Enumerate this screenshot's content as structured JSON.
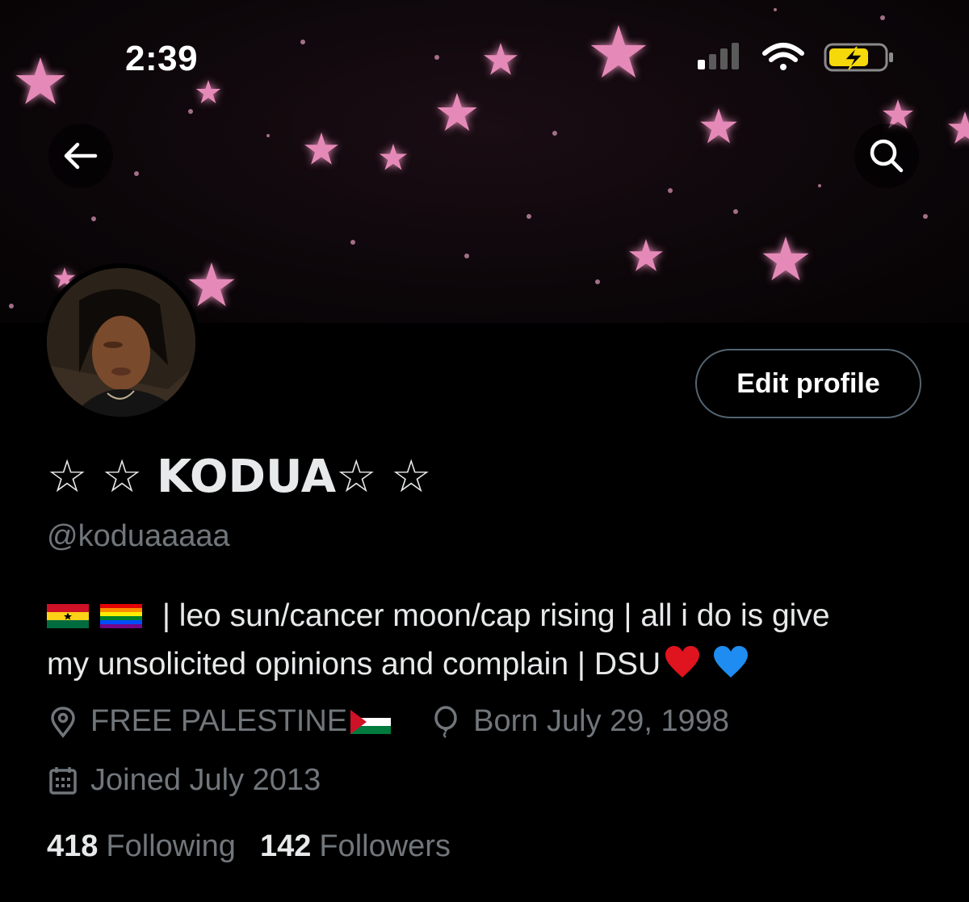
{
  "status_bar": {
    "time": "2:39",
    "icons": [
      "signal-icon",
      "wifi-icon",
      "battery-charging-icon"
    ],
    "battery_color": "#f5d90a"
  },
  "nav": {
    "back_icon": "arrow-left-icon",
    "search_icon": "search-icon"
  },
  "banner": {
    "theme": "pink stars on black",
    "star_color": "#e58ab8"
  },
  "profile": {
    "edit_button_label": "Edit profile",
    "display_name": {
      "prefix": "☆ ☆ ",
      "name": "KODUA",
      "suffix": "☆ ☆"
    },
    "handle": "@koduaaaaa",
    "bio": {
      "flags": [
        "ghana-flag",
        "rainbow-flag"
      ],
      "text_line1": " | leo sun/cancer moon/cap rising | all i do is give",
      "text_line2": "my unsolicited opinions and complain | DSU",
      "hearts": [
        "red-heart",
        "blue-heart"
      ]
    },
    "location": "FREE PALESTINE",
    "location_flag": "palestine-flag",
    "birthday": "Born July 29, 1998",
    "joined": "Joined July 2013",
    "following_count": "418",
    "following_label": "Following",
    "followers_count": "142",
    "followers_label": "Followers"
  },
  "colors": {
    "background": "#000000",
    "text_primary": "#e7e9ea",
    "text_secondary": "#71767b",
    "button_border": "#536471"
  }
}
